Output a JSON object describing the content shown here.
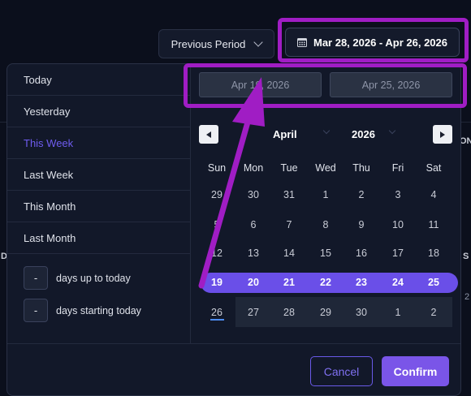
{
  "toolbar": {
    "previous_period_label": "Previous Period",
    "date_range_label": "Mar 28, 2026 - Apr 26, 2026"
  },
  "presets": [
    {
      "label": "Today",
      "active": false
    },
    {
      "label": "Yesterday",
      "active": false
    },
    {
      "label": "This Week",
      "active": true
    },
    {
      "label": "Last Week",
      "active": false
    },
    {
      "label": "This Month",
      "active": false
    },
    {
      "label": "Last Month",
      "active": false
    }
  ],
  "relative": {
    "minus_symbol": "-",
    "up_to_today_label": "days up to today",
    "starting_today_label": "days starting today"
  },
  "inputs": {
    "start_date": "Apr 19, 2026",
    "end_date": "Apr 25, 2026"
  },
  "calendar": {
    "month": "April",
    "year": "2026",
    "weekdays": [
      "Sun",
      "Mon",
      "Tue",
      "Wed",
      "Thu",
      "Fri",
      "Sat"
    ],
    "weeks": [
      [
        "29",
        "30",
        "31",
        "1",
        "2",
        "3",
        "4"
      ],
      [
        "5",
        "6",
        "7",
        "8",
        "9",
        "10",
        "11"
      ],
      [
        "12",
        "13",
        "14",
        "15",
        "16",
        "17",
        "18"
      ],
      [
        "19",
        "20",
        "21",
        "22",
        "23",
        "24",
        "25"
      ],
      [
        "26",
        "27",
        "28",
        "29",
        "30",
        "1",
        "2"
      ]
    ],
    "selected_week_index": 3,
    "today": "26"
  },
  "footer": {
    "cancel_label": "Cancel",
    "confirm_label": "Confirm"
  },
  "background": {
    "fragment_right_top": "ON",
    "fragment_right_mid": "S",
    "fragment_right_low": "2",
    "fragment_left": "D"
  },
  "colors": {
    "accent": "#6a4fe8",
    "highlight_annotation": "#a01dc4",
    "panel_bg": "#121829",
    "page_bg": "#0b0f1c"
  }
}
